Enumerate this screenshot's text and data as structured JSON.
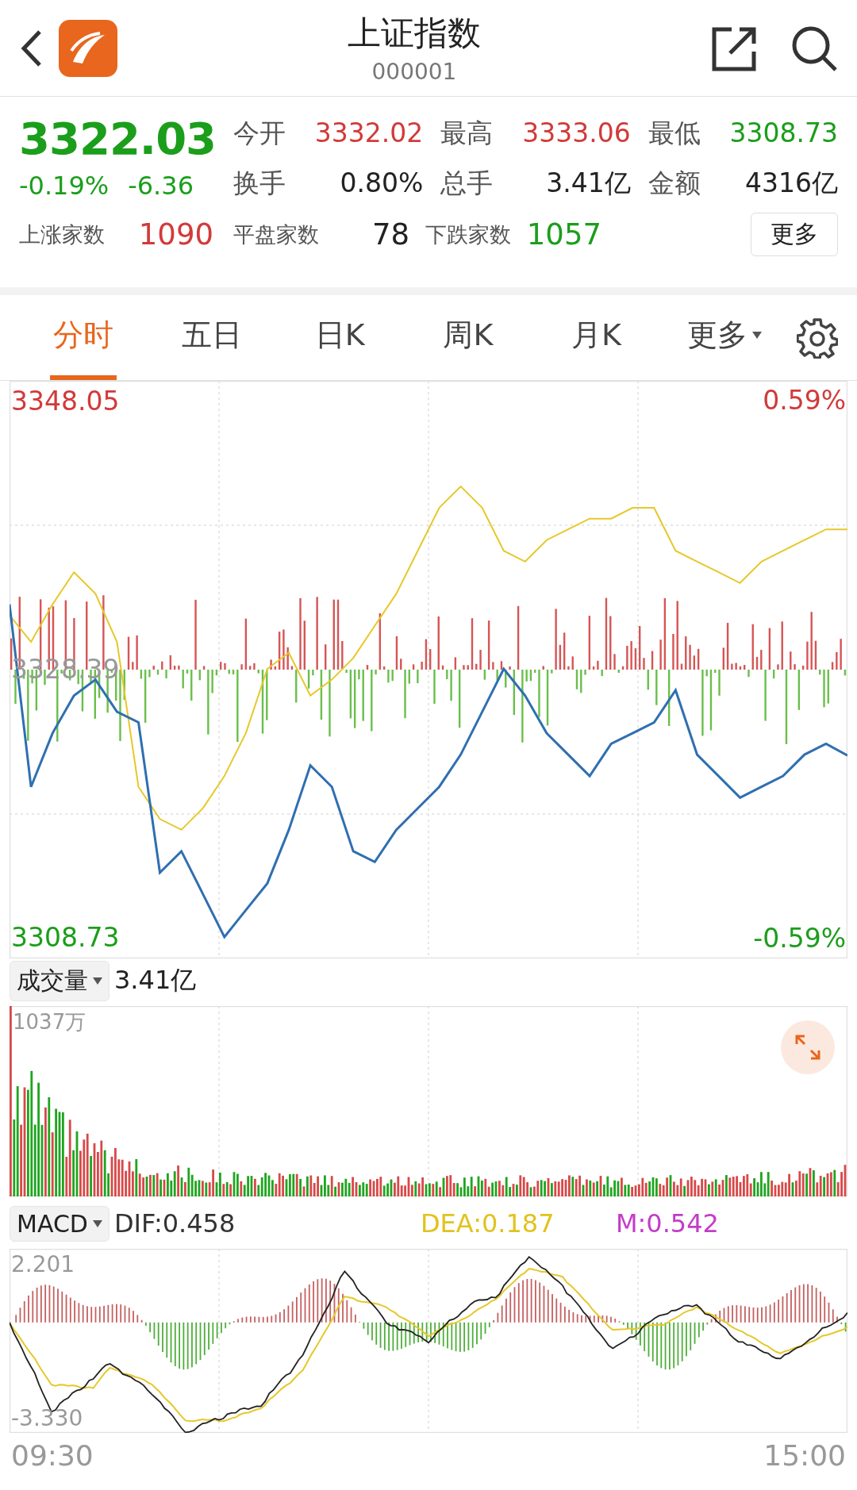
{
  "header": {
    "title": "上证指数",
    "code": "000001"
  },
  "quote": {
    "price": "3322.03",
    "color": "#1b9e1b",
    "change_pct": "-0.19%",
    "change": "-6.36",
    "stats": [
      {
        "label": "今开",
        "value": "3332.02",
        "color": "#d23a3a"
      },
      {
        "label": "最高",
        "value": "3333.06",
        "color": "#d23a3a"
      },
      {
        "label": "最低",
        "value": "3308.73",
        "color": "#1b9e1b"
      },
      {
        "label": "换手",
        "value": "0.80%",
        "color": "#222222"
      },
      {
        "label": "总手",
        "value": "3.41亿",
        "color": "#222222"
      },
      {
        "label": "金额",
        "value": "4316亿",
        "color": "#222222"
      }
    ],
    "breadth": [
      {
        "label": "上涨家数",
        "value": "1090",
        "color": "#d23a3a"
      },
      {
        "label": "平盘家数",
        "value": "78",
        "color": "#222222"
      },
      {
        "label": "下跌家数",
        "value": "1057",
        "color": "#1b9e1b"
      }
    ],
    "more_button": "更多"
  },
  "tabs": [
    {
      "label": "分时",
      "selected": true,
      "dropdown": false
    },
    {
      "label": "五日",
      "selected": false,
      "dropdown": false
    },
    {
      "label": "日K",
      "selected": false,
      "dropdown": false
    },
    {
      "label": "周K",
      "selected": false,
      "dropdown": false
    },
    {
      "label": "月K",
      "selected": false,
      "dropdown": false
    },
    {
      "label": "更多",
      "selected": false,
      "dropdown": true
    }
  ],
  "price_chart": {
    "pct_high": "0.59%",
    "pct_low": "-0.59%",
    "chart_data": {
      "type": "line",
      "ylim": [
        3307.16,
        3349.5
      ],
      "yticks": [
        {
          "value": 3348.05,
          "label": "3348.05"
        },
        {
          "value": 3328.39,
          "label": "3328.39"
        },
        {
          "value": 3308.73,
          "label": "3308.73"
        }
      ],
      "series": [
        {
          "color": "#2f6fb0",
          "values": [
            3333.11,
            3319.74,
            3323.67,
            3326.42,
            3327.6,
            3325.24,
            3324.46,
            3313.45,
            3315.02,
            3311.88,
            3308.73,
            3310.7,
            3312.66,
            3316.59,
            3321.31,
            3319.74,
            3315.02,
            3314.23,
            3316.59,
            3318.17,
            3319.74,
            3322.1,
            3325.24,
            3328.39,
            3326.42,
            3323.67,
            3322.1,
            3320.53,
            3322.89,
            3323.67,
            3324.46,
            3326.82,
            3322.1,
            3320.53,
            3318.95,
            3319.74,
            3320.53,
            3322.1,
            3322.89,
            3322.03
          ]
        },
        {
          "color": "#e6c82a",
          "values": [
            3332.32,
            3330.36,
            3333.11,
            3335.47,
            3333.89,
            3330.36,
            3319.74,
            3317.38,
            3316.59,
            3318.17,
            3320.53,
            3323.67,
            3328.39,
            3329.57,
            3326.42,
            3327.6,
            3329.18,
            3331.54,
            3333.89,
            3337.04,
            3340.19,
            3341.76,
            3340.19,
            3337.04,
            3336.25,
            3337.83,
            3338.61,
            3339.4,
            3339.4,
            3340.19,
            3340.19,
            3337.04,
            3336.25,
            3335.47,
            3334.68,
            3336.25,
            3337.04,
            3337.83,
            3338.61,
            3338.61
          ]
        }
      ]
    }
  },
  "volume": {
    "indicator": "成交量",
    "total": "3.41亿",
    "max": "1037万"
  },
  "macd": {
    "indicator": "MACD",
    "indicators": [
      {
        "label": "DIF:0.458",
        "color": "#333333"
      },
      {
        "label": "DEA:0.187",
        "color": "#e2c21e"
      },
      {
        "label": "M:0.542",
        "color": "#c43cc8"
      }
    ],
    "y_high": "2.201",
    "y_low": "-3.330"
  },
  "time_axis": {
    "start": "09:30",
    "end": "15:00"
  }
}
